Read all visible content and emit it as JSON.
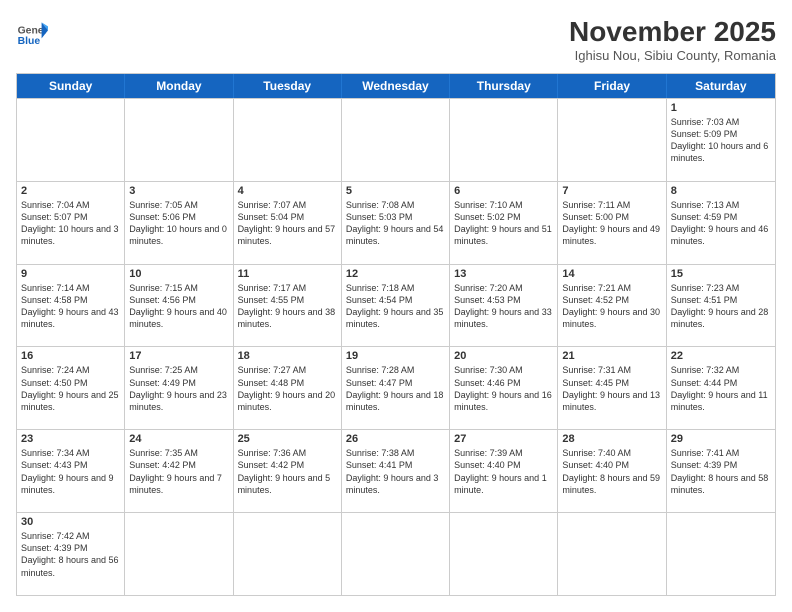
{
  "header": {
    "logo": {
      "general": "General",
      "blue": "Blue"
    },
    "title": "November 2025",
    "location": "Ighisu Nou, Sibiu County, Romania"
  },
  "days_of_week": [
    "Sunday",
    "Monday",
    "Tuesday",
    "Wednesday",
    "Thursday",
    "Friday",
    "Saturday"
  ],
  "rows": [
    [
      {
        "day": "",
        "data": ""
      },
      {
        "day": "",
        "data": ""
      },
      {
        "day": "",
        "data": ""
      },
      {
        "day": "",
        "data": ""
      },
      {
        "day": "",
        "data": ""
      },
      {
        "day": "",
        "data": ""
      },
      {
        "day": "1",
        "data": "Sunrise: 7:03 AM\nSunset: 5:09 PM\nDaylight: 10 hours and 6 minutes."
      }
    ],
    [
      {
        "day": "2",
        "data": "Sunrise: 7:04 AM\nSunset: 5:07 PM\nDaylight: 10 hours and 3 minutes."
      },
      {
        "day": "3",
        "data": "Sunrise: 7:05 AM\nSunset: 5:06 PM\nDaylight: 10 hours and 0 minutes."
      },
      {
        "day": "4",
        "data": "Sunrise: 7:07 AM\nSunset: 5:04 PM\nDaylight: 9 hours and 57 minutes."
      },
      {
        "day": "5",
        "data": "Sunrise: 7:08 AM\nSunset: 5:03 PM\nDaylight: 9 hours and 54 minutes."
      },
      {
        "day": "6",
        "data": "Sunrise: 7:10 AM\nSunset: 5:02 PM\nDaylight: 9 hours and 51 minutes."
      },
      {
        "day": "7",
        "data": "Sunrise: 7:11 AM\nSunset: 5:00 PM\nDaylight: 9 hours and 49 minutes."
      },
      {
        "day": "8",
        "data": "Sunrise: 7:13 AM\nSunset: 4:59 PM\nDaylight: 9 hours and 46 minutes."
      }
    ],
    [
      {
        "day": "9",
        "data": "Sunrise: 7:14 AM\nSunset: 4:58 PM\nDaylight: 9 hours and 43 minutes."
      },
      {
        "day": "10",
        "data": "Sunrise: 7:15 AM\nSunset: 4:56 PM\nDaylight: 9 hours and 40 minutes."
      },
      {
        "day": "11",
        "data": "Sunrise: 7:17 AM\nSunset: 4:55 PM\nDaylight: 9 hours and 38 minutes."
      },
      {
        "day": "12",
        "data": "Sunrise: 7:18 AM\nSunset: 4:54 PM\nDaylight: 9 hours and 35 minutes."
      },
      {
        "day": "13",
        "data": "Sunrise: 7:20 AM\nSunset: 4:53 PM\nDaylight: 9 hours and 33 minutes."
      },
      {
        "day": "14",
        "data": "Sunrise: 7:21 AM\nSunset: 4:52 PM\nDaylight: 9 hours and 30 minutes."
      },
      {
        "day": "15",
        "data": "Sunrise: 7:23 AM\nSunset: 4:51 PM\nDaylight: 9 hours and 28 minutes."
      }
    ],
    [
      {
        "day": "16",
        "data": "Sunrise: 7:24 AM\nSunset: 4:50 PM\nDaylight: 9 hours and 25 minutes."
      },
      {
        "day": "17",
        "data": "Sunrise: 7:25 AM\nSunset: 4:49 PM\nDaylight: 9 hours and 23 minutes."
      },
      {
        "day": "18",
        "data": "Sunrise: 7:27 AM\nSunset: 4:48 PM\nDaylight: 9 hours and 20 minutes."
      },
      {
        "day": "19",
        "data": "Sunrise: 7:28 AM\nSunset: 4:47 PM\nDaylight: 9 hours and 18 minutes."
      },
      {
        "day": "20",
        "data": "Sunrise: 7:30 AM\nSunset: 4:46 PM\nDaylight: 9 hours and 16 minutes."
      },
      {
        "day": "21",
        "data": "Sunrise: 7:31 AM\nSunset: 4:45 PM\nDaylight: 9 hours and 13 minutes."
      },
      {
        "day": "22",
        "data": "Sunrise: 7:32 AM\nSunset: 4:44 PM\nDaylight: 9 hours and 11 minutes."
      }
    ],
    [
      {
        "day": "23",
        "data": "Sunrise: 7:34 AM\nSunset: 4:43 PM\nDaylight: 9 hours and 9 minutes."
      },
      {
        "day": "24",
        "data": "Sunrise: 7:35 AM\nSunset: 4:42 PM\nDaylight: 9 hours and 7 minutes."
      },
      {
        "day": "25",
        "data": "Sunrise: 7:36 AM\nSunset: 4:42 PM\nDaylight: 9 hours and 5 minutes."
      },
      {
        "day": "26",
        "data": "Sunrise: 7:38 AM\nSunset: 4:41 PM\nDaylight: 9 hours and 3 minutes."
      },
      {
        "day": "27",
        "data": "Sunrise: 7:39 AM\nSunset: 4:40 PM\nDaylight: 9 hours and 1 minute."
      },
      {
        "day": "28",
        "data": "Sunrise: 7:40 AM\nSunset: 4:40 PM\nDaylight: 8 hours and 59 minutes."
      },
      {
        "day": "29",
        "data": "Sunrise: 7:41 AM\nSunset: 4:39 PM\nDaylight: 8 hours and 58 minutes."
      }
    ],
    [
      {
        "day": "30",
        "data": "Sunrise: 7:42 AM\nSunset: 4:39 PM\nDaylight: 8 hours and 56 minutes."
      },
      {
        "day": "",
        "data": ""
      },
      {
        "day": "",
        "data": ""
      },
      {
        "day": "",
        "data": ""
      },
      {
        "day": "",
        "data": ""
      },
      {
        "day": "",
        "data": ""
      },
      {
        "day": "",
        "data": ""
      }
    ]
  ]
}
